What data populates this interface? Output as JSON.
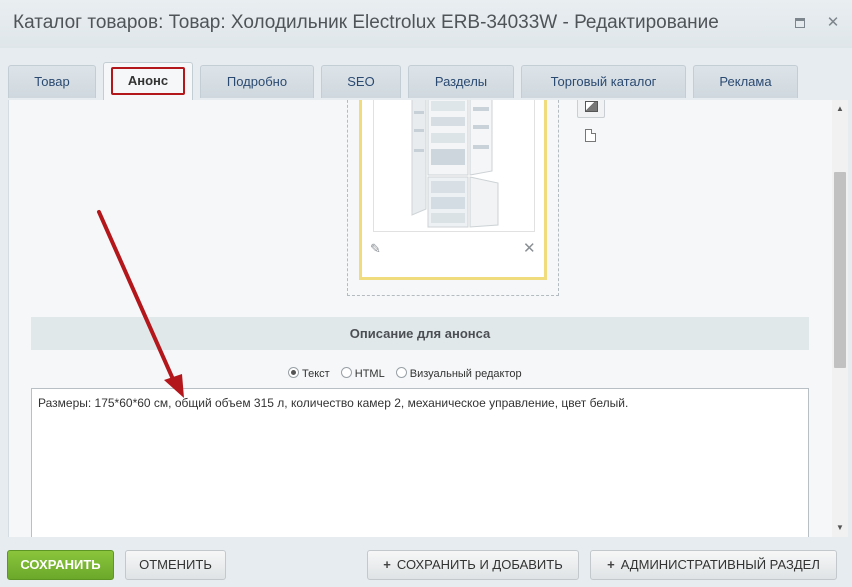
{
  "window": {
    "title": "Каталог товаров: Товар: Холодильник Electrolux ERB-34033W - Редактирование"
  },
  "tabs": [
    {
      "label": "Товар",
      "active": false
    },
    {
      "label": "Анонс",
      "active": true
    },
    {
      "label": "Подробно",
      "active": false
    },
    {
      "label": "SEO",
      "active": false
    },
    {
      "label": "Разделы",
      "active": false
    },
    {
      "label": "Торговый каталог",
      "active": false
    },
    {
      "label": "Реклама",
      "active": false
    }
  ],
  "preview": {
    "section_title": "Описание для анонса",
    "format_options": [
      {
        "label": "Текст",
        "checked": true
      },
      {
        "label": "HTML",
        "checked": false
      },
      {
        "label": "Визуальный редактор",
        "checked": false
      }
    ],
    "text": "Размеры: 175*60*60 см, общий объем 315 л, количество камер 2, механическое управление, цвет белый."
  },
  "footer": {
    "save_label": "СОХРАНИТЬ",
    "cancel_label": "ОТМЕНИТЬ",
    "save_add_label": "СОХРАНИТЬ И ДОБАВИТЬ",
    "admin_label": "АДМИНИСТРАТИВНЫЙ РАЗДЕЛ"
  },
  "icons": {
    "restore": "restore-icon",
    "close": "close-icon",
    "edit": "pencil-icon",
    "remove": "remove-icon",
    "image_type": "image-type-icon",
    "file_type": "file-type-icon",
    "plus": "plus-icon"
  },
  "colors": {
    "save_button": "#7ab632",
    "active_tab_outline": "#b3161b",
    "annotation_arrow": "#b3161b",
    "image_frame": "#f0dc7d"
  }
}
